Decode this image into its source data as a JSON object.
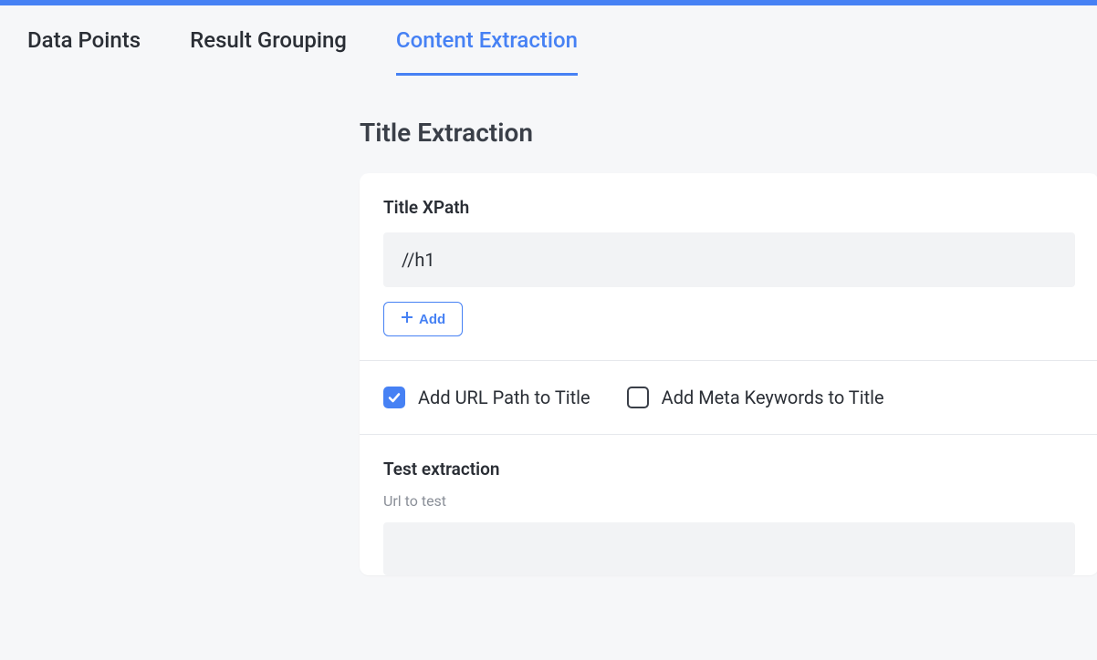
{
  "tabs": [
    {
      "label": "Data Points",
      "active": false
    },
    {
      "label": "Result Grouping",
      "active": false
    },
    {
      "label": "Content Extraction",
      "active": true
    }
  ],
  "section": {
    "title": "Title Extraction"
  },
  "titleXpath": {
    "label": "Title XPath",
    "value": "//h1",
    "addButton": "Add"
  },
  "checkboxes": {
    "addUrlPath": {
      "label": "Add URL Path to Title",
      "checked": true
    },
    "addMetaKeywords": {
      "label": "Add Meta Keywords to Title",
      "checked": false
    }
  },
  "testExtraction": {
    "title": "Test extraction",
    "urlLabel": "Url to test",
    "urlValue": ""
  }
}
